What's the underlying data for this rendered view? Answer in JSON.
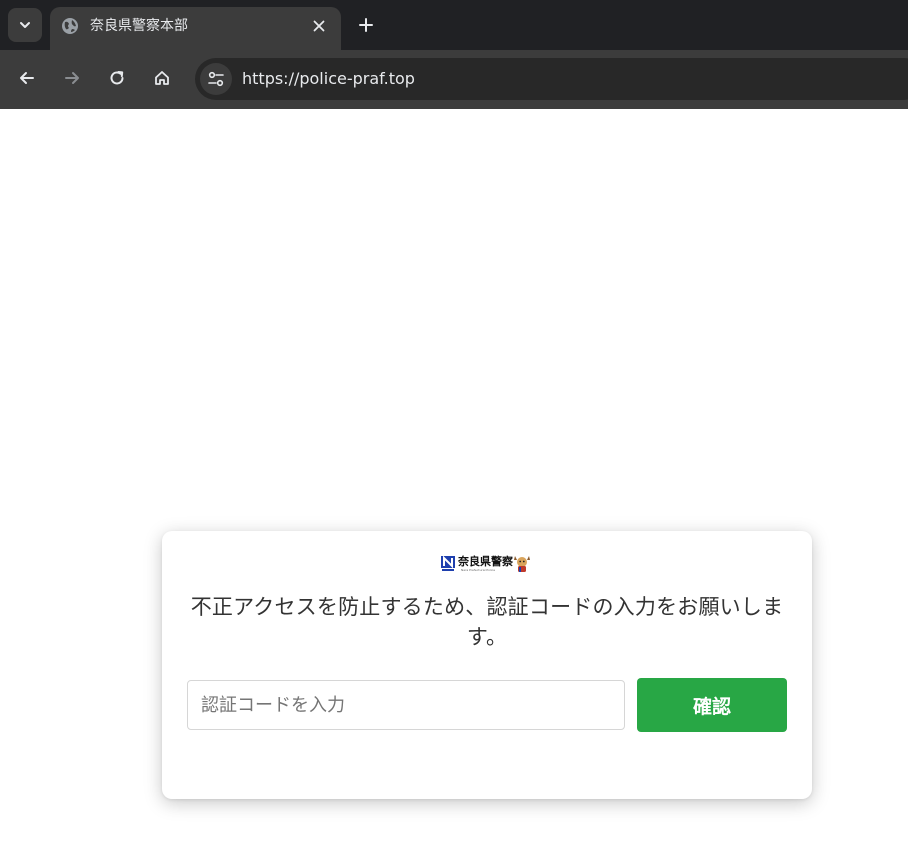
{
  "browser": {
    "tab": {
      "title": "奈良県警察本部",
      "favicon": "globe-icon"
    },
    "address_bar": {
      "url": "https://police-praf.top"
    },
    "icons": {
      "tab_search": "chevron-down-icon",
      "close_tab": "close-icon",
      "new_tab": "plus-icon",
      "back": "arrow-left-icon",
      "forward": "arrow-right-icon",
      "reload": "reload-icon",
      "home": "home-icon",
      "site_info": "tune-icon"
    }
  },
  "card": {
    "logo": {
      "text": "奈良県警察",
      "subtitle": "Nara Prefectural Police",
      "mark": "N",
      "mascot": "mascot-icon"
    },
    "message": "不正アクセスを防止するため、認証コードの入力をお願いします。",
    "code_input": {
      "value": "",
      "placeholder": "認証コードを入力"
    },
    "confirm_label": "確認"
  },
  "colors": {
    "tabstrip_bg": "#202124",
    "toolbar_bg": "#3c3c3c",
    "confirm_button": "#28a745",
    "logo_blue": "#1e3fae"
  }
}
